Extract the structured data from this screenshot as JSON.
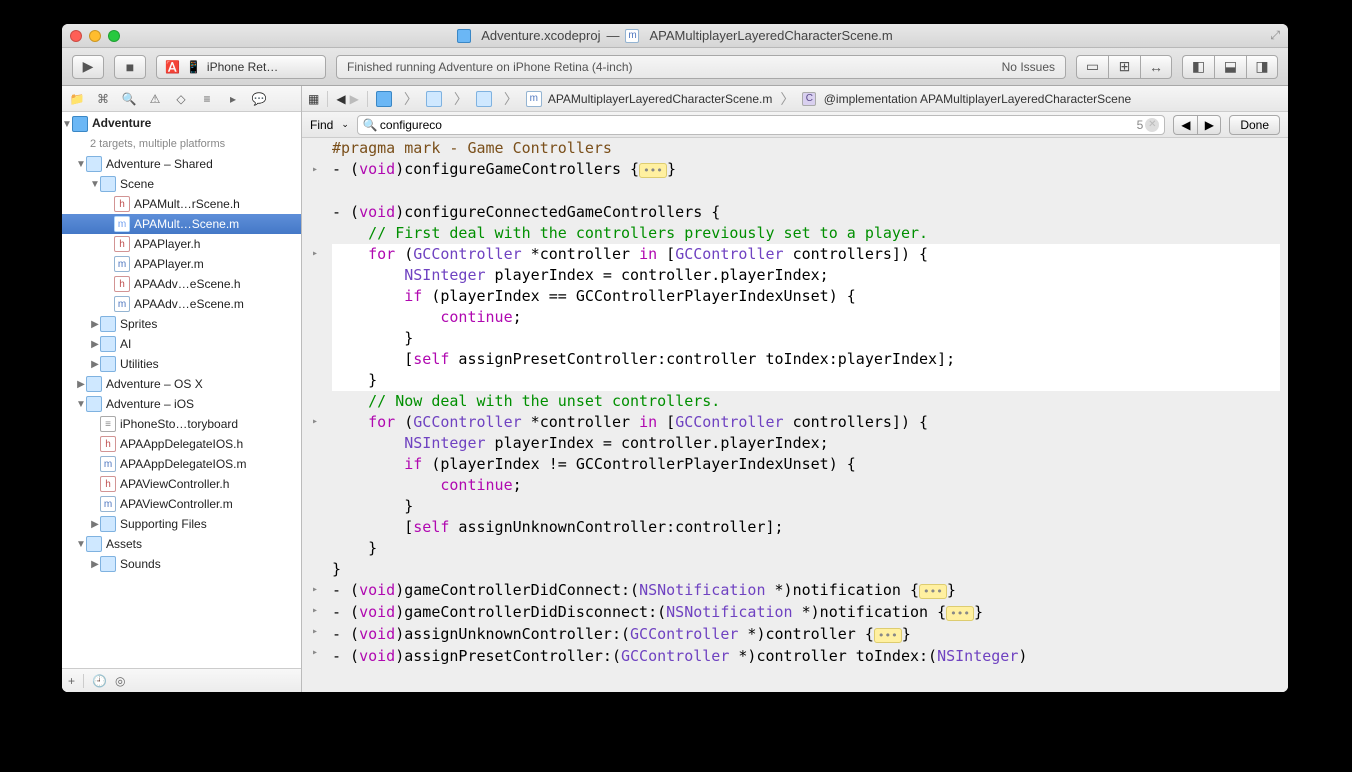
{
  "title": {
    "project": "Adventure.xcodeproj",
    "separator": "—",
    "file": "APAMultiplayerLayeredCharacterScene.m"
  },
  "toolbar": {
    "scheme_app": "A",
    "scheme_device": "iPhone Ret…",
    "activity_text": "Finished running Adventure on iPhone Retina (4-inch)",
    "activity_issues": "No Issues"
  },
  "navigator": {
    "project": "Adventure",
    "project_sub": "2 targets, multiple platforms",
    "tree": [
      {
        "d": 1,
        "type": "folder",
        "label": "Adventure – Shared",
        "open": true
      },
      {
        "d": 2,
        "type": "folder",
        "label": "Scene",
        "open": true
      },
      {
        "d": 3,
        "type": "h",
        "label": "APAMult…rScene.h"
      },
      {
        "d": 3,
        "type": "m",
        "label": "APAMult…Scene.m",
        "sel": true
      },
      {
        "d": 3,
        "type": "h",
        "label": "APAPlayer.h"
      },
      {
        "d": 3,
        "type": "m",
        "label": "APAPlayer.m"
      },
      {
        "d": 3,
        "type": "h",
        "label": "APAAdv…eScene.h"
      },
      {
        "d": 3,
        "type": "m",
        "label": "APAAdv…eScene.m"
      },
      {
        "d": 2,
        "type": "folder",
        "label": "Sprites",
        "open": false
      },
      {
        "d": 2,
        "type": "folder",
        "label": "AI",
        "open": false
      },
      {
        "d": 2,
        "type": "folder",
        "label": "Utilities",
        "open": false
      },
      {
        "d": 1,
        "type": "folder",
        "label": "Adventure – OS X",
        "open": false
      },
      {
        "d": 1,
        "type": "folder",
        "label": "Adventure – iOS",
        "open": true
      },
      {
        "d": 2,
        "type": "sb",
        "label": "iPhoneSto…toryboard"
      },
      {
        "d": 2,
        "type": "h",
        "label": "APAAppDelegateIOS.h"
      },
      {
        "d": 2,
        "type": "m",
        "label": "APAAppDelegateIOS.m"
      },
      {
        "d": 2,
        "type": "h",
        "label": "APAViewController.h"
      },
      {
        "d": 2,
        "type": "m",
        "label": "APAViewController.m"
      },
      {
        "d": 2,
        "type": "folder",
        "label": "Supporting Files",
        "open": false
      },
      {
        "d": 1,
        "type": "folder",
        "label": "Assets",
        "open": true
      },
      {
        "d": 2,
        "type": "folder",
        "label": "Sounds",
        "open": false
      }
    ]
  },
  "jumpbar": {
    "file": "APAMultiplayerLayeredCharacterScene.m",
    "symbol": "@implementation APAMultiplayerLayeredCharacterScene"
  },
  "findbar": {
    "mode": "Find",
    "query": "configureco",
    "count": "5",
    "done": "Done"
  },
  "code": {
    "lines": [
      {
        "fold": "",
        "html": "<span class='pragma'>#pragma mark - Game Controllers</span>"
      },
      {
        "fold": "▸",
        "html": "- (<span class='kw'>void</span>)configureGameControllers {<span class='ellips'>•••</span>}"
      },
      {
        "fold": "",
        "html": ""
      },
      {
        "fold": "",
        "html": "- (<span class='kw'>void</span>)configureConnectedGameControllers {"
      },
      {
        "fold": "",
        "html": "    <span class='cmt'>// First deal with the controllers previously set to a player.</span>"
      },
      {
        "fold": "▸",
        "hl": true,
        "html": "    <span class='kw'>for</span> (<span class='type'>GCController</span> *controller <span class='kw'>in</span> [<span class='type'>GCController</span> controllers]) {"
      },
      {
        "fold": "",
        "hl": true,
        "html": "        <span class='type'>NSInteger</span> playerIndex = controller.playerIndex;"
      },
      {
        "fold": "",
        "hl": true,
        "html": "        <span class='kw'>if</span> (playerIndex == GCControllerPlayerIndexUnset) {"
      },
      {
        "fold": "",
        "hl": true,
        "html": "            <span class='kw'>continue</span>;"
      },
      {
        "fold": "",
        "hl": true,
        "html": "        }"
      },
      {
        "fold": "",
        "hl": true,
        "html": "        [<span class='kw'>self</span> assignPresetController:controller toIndex:playerIndex];"
      },
      {
        "fold": "",
        "hl": true,
        "html": "    }"
      },
      {
        "fold": "",
        "html": "    <span class='cmt'>// Now deal with the unset controllers.</span>"
      },
      {
        "fold": "▸",
        "html": "    <span class='kw'>for</span> (<span class='type'>GCController</span> *controller <span class='kw'>in</span> [<span class='type'>GCController</span> controllers]) {"
      },
      {
        "fold": "",
        "html": "        <span class='type'>NSInteger</span> playerIndex = controller.playerIndex;"
      },
      {
        "fold": "",
        "html": "        <span class='kw'>if</span> (playerIndex != GCControllerPlayerIndexUnset) {"
      },
      {
        "fold": "",
        "html": "            <span class='kw'>continue</span>;"
      },
      {
        "fold": "",
        "html": "        }"
      },
      {
        "fold": "",
        "html": "        [<span class='kw'>self</span> assignUnknownController:controller];"
      },
      {
        "fold": "",
        "html": "    }"
      },
      {
        "fold": "",
        "html": "}"
      },
      {
        "fold": "▸",
        "html": "- (<span class='kw'>void</span>)gameControllerDidConnect:(<span class='type'>NSNotification</span> *)notification {<span class='ellips'>•••</span>}"
      },
      {
        "fold": "▸",
        "html": "- (<span class='kw'>void</span>)gameControllerDidDisconnect:(<span class='type'>NSNotification</span> *)notification {<span class='ellips'>•••</span>}"
      },
      {
        "fold": "▸",
        "html": "- (<span class='kw'>void</span>)assignUnknownController:(<span class='type'>GCController</span> *)controller {<span class='ellips'>•••</span>}"
      },
      {
        "fold": "▸",
        "html": "- (<span class='kw'>void</span>)assignPresetController:(<span class='type'>GCController</span> *)controller toIndex:(<span class='type'>NSInteger</span>)"
      }
    ]
  }
}
